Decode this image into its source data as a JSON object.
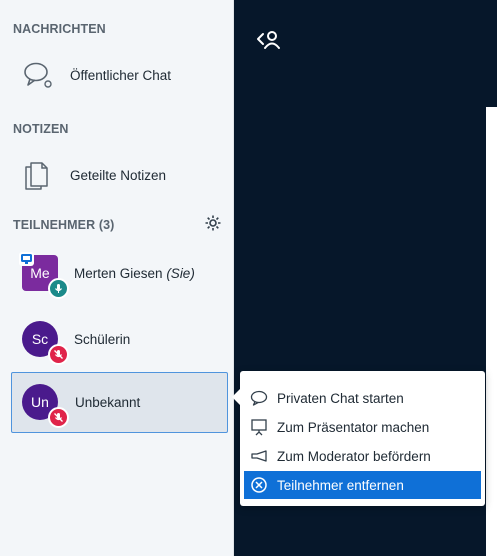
{
  "sidebar": {
    "messages_title": "NACHRICHTEN",
    "public_chat_label": "Öffentlicher Chat",
    "notes_title": "NOTIZEN",
    "shared_notes_label": "Geteilte Notizen",
    "participants_title": "TEILNEHMER (3)",
    "users": [
      {
        "initials": "Me",
        "name": "Merten Giesen",
        "you": "(Sie)",
        "color": "#7b2b9e",
        "shape": "square",
        "badge_color": "#1b8a8a"
      },
      {
        "initials": "Sc",
        "name": "Schülerin",
        "color": "#4a1a8c",
        "shape": "round",
        "badge_color": "#e0244a"
      },
      {
        "initials": "Un",
        "name": "Unbekannt",
        "color": "#4a1a8c",
        "shape": "round",
        "badge_color": "#e0244a"
      }
    ]
  },
  "context_menu": {
    "items": [
      {
        "label": "Privaten Chat starten",
        "icon": "chat-icon"
      },
      {
        "label": "Zum Präsentator machen",
        "icon": "presentation-icon"
      },
      {
        "label": "Zum Moderator befördern",
        "icon": "promote-icon"
      },
      {
        "label": "Teilnehmer entfernen",
        "icon": "remove-icon",
        "active": true
      }
    ]
  },
  "colors": {
    "main_bg": "#06172a",
    "accent": "#0f70d7",
    "sidebar_bg": "#f3f6f9"
  }
}
